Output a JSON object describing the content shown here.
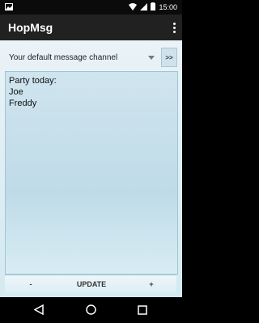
{
  "status": {
    "time": "15:00"
  },
  "appbar": {
    "title": "HopMsg"
  },
  "channel": {
    "selected": "Your default message channel",
    "go_label": ">>"
  },
  "message": {
    "text": "Party today:\nJoe\nFreddy"
  },
  "buttons": {
    "minus": "-",
    "update": "UPDATE",
    "plus": "+"
  }
}
